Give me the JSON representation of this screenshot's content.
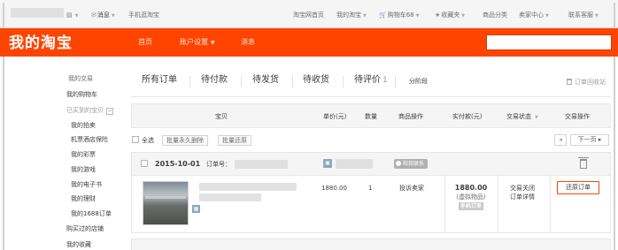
{
  "topbar": {
    "messages": "消息",
    "mobile": "手机逛淘宝",
    "home": "淘宝网首页",
    "my_taobao": "我的淘宝",
    "cart": "购物车68",
    "favorites": "收藏夹",
    "categories": "商品分类",
    "seller_center": "卖家中心",
    "contact": "联系客服"
  },
  "header": {
    "logo": "我的淘宝",
    "nav": [
      "首页",
      "账户设置",
      "消息"
    ]
  },
  "sidebar": {
    "section_title": "我的交易",
    "cart": "我的购物车",
    "bought": "已买到的宝贝",
    "items": [
      "我的拍卖",
      "机票酒店保险",
      "我的彩票",
      "我的游戏",
      "我的电子书",
      "我的理财",
      "我的1688订单"
    ],
    "paid_for_me": "购买过的店铺",
    "collections": "我的收藏"
  },
  "tabs": {
    "all": "所有订单",
    "to_pay": "待付款",
    "to_ship": "待发货",
    "to_receive": "待收货",
    "to_review": "待评价",
    "to_review_count": "1",
    "staged": "分阶段",
    "recycle": "订单回收站"
  },
  "columns": {
    "item": "宝贝",
    "unit_price": "单价(元)",
    "quantity": "数量",
    "item_ops": "商品操作",
    "paid": "实付款(元)",
    "status": "交易状态",
    "ops": "交易操作"
  },
  "batch": {
    "select_all": "全选",
    "delete_forever": "批量永久删除",
    "restore": "批量还原",
    "prev": "◂",
    "next": "下一页 ▸"
  },
  "order": {
    "date": "2015-10-01",
    "order_no_label": "订单号：",
    "wangwang": "和我联系",
    "unit_price": "1880.00",
    "quantity": "1",
    "complain": "投诉卖家",
    "paid": "1880.00",
    "paid_note": "(虚拟物品)",
    "paid_tag": "手机订单",
    "status": "交易关闭",
    "detail": "订单详情",
    "action": "还原订单"
  }
}
